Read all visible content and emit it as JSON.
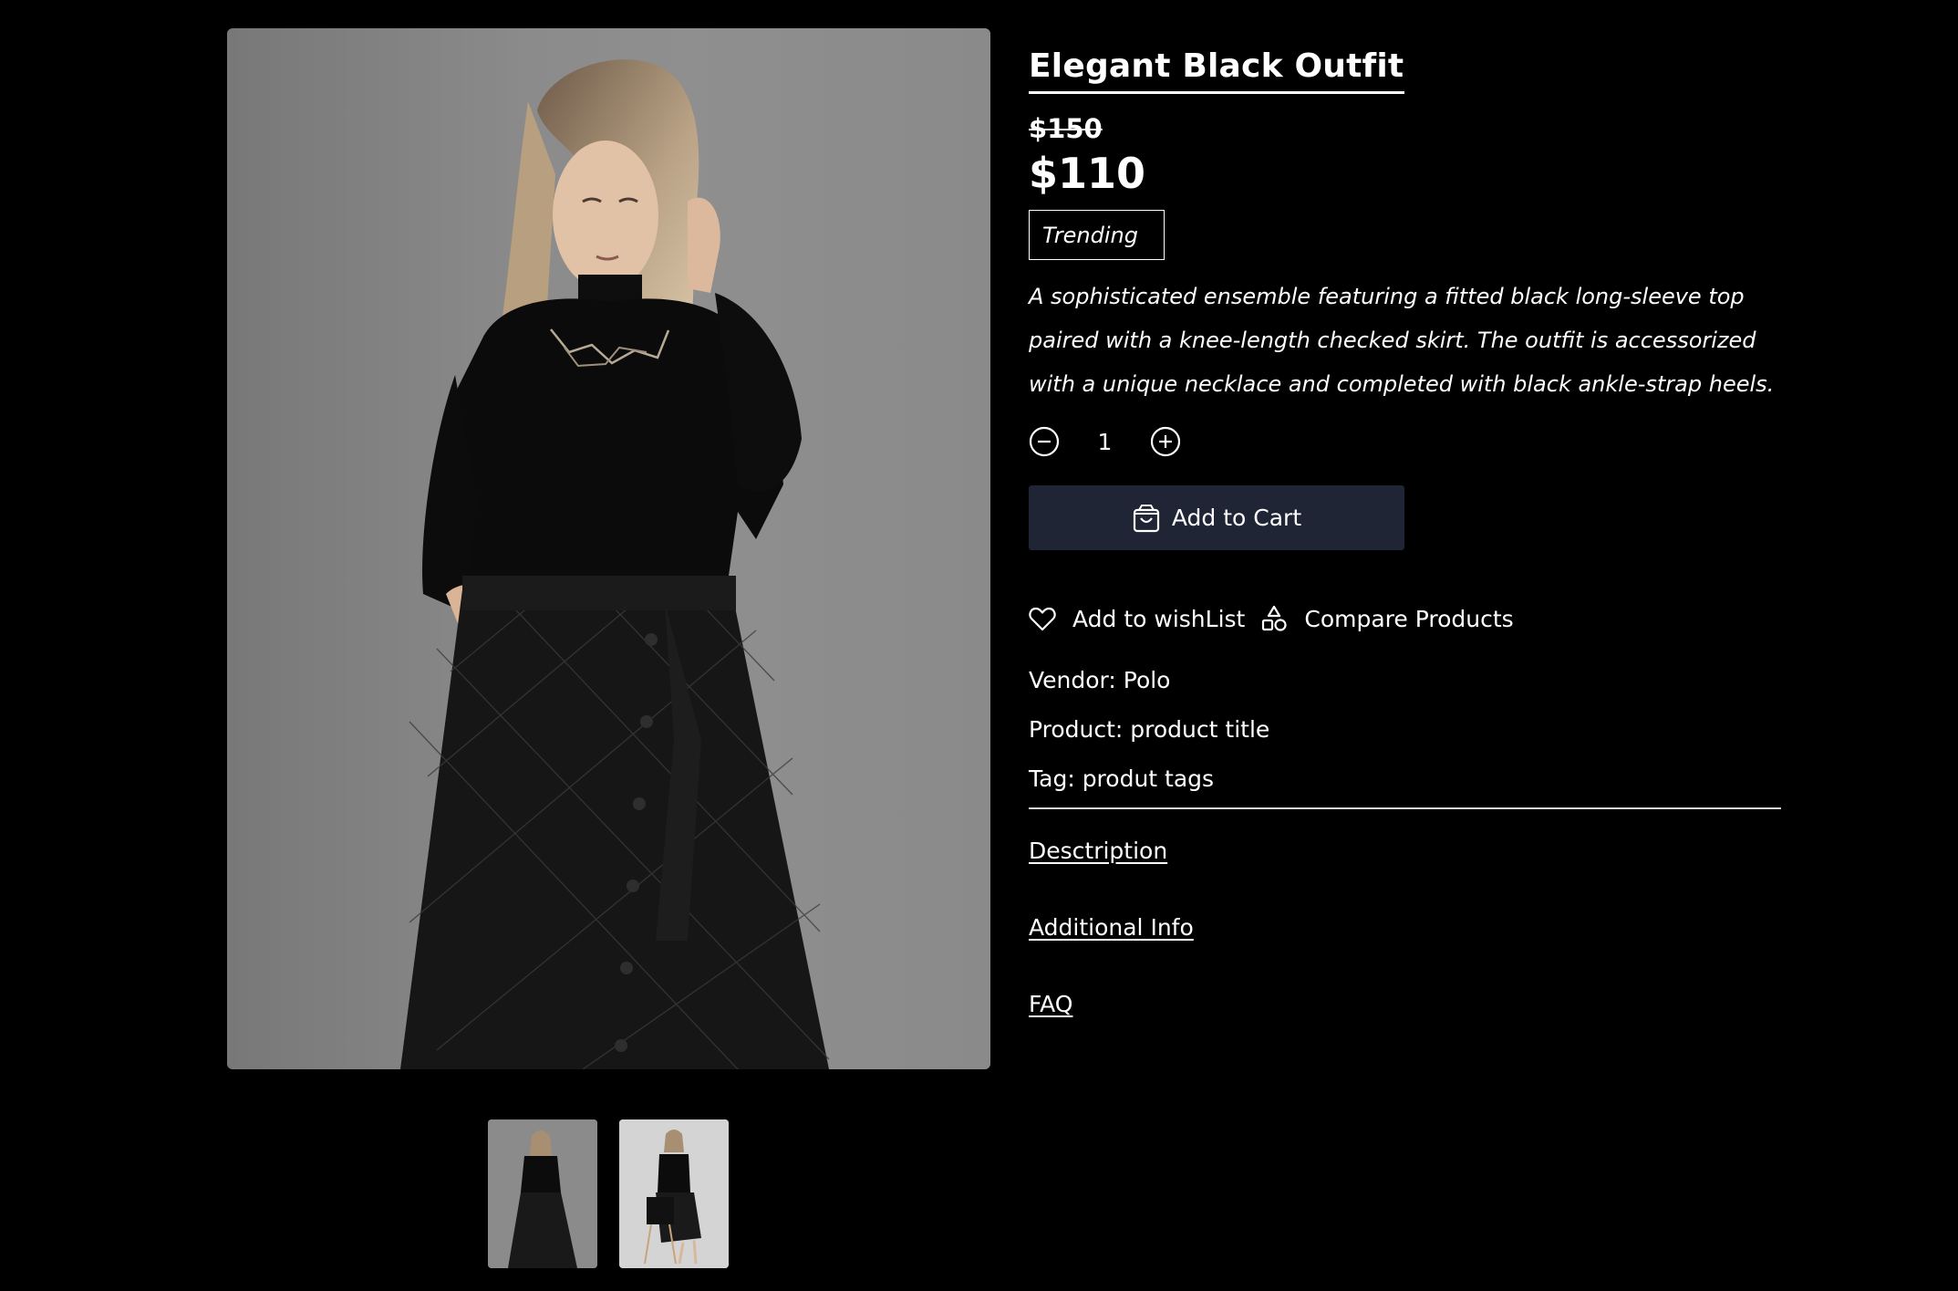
{
  "product": {
    "title": "Elegant Black Outfit",
    "old_price": "$150",
    "price": "$110",
    "badge": "Trending",
    "description": "A sophisticated ensemble featuring a fitted black long-sleeve top paired with a knee-length checked skirt. The outfit is accessorized with a unique necklace and completed with black ankle-strap heels."
  },
  "quantity": {
    "value": "1",
    "decrease_icon": "minus-circle-icon",
    "increase_icon": "plus-circle-icon"
  },
  "cart": {
    "label": "Add to Cart",
    "icon": "shopping-bag-icon"
  },
  "actions": {
    "wishlist_label": "Add to wishList",
    "wishlist_icon": "heart-icon",
    "compare_label": "Compare Products",
    "compare_icon": "shapes-icon"
  },
  "meta": {
    "vendor": "Vendor: Polo",
    "product": "Product: product title",
    "tag": "Tag: produt tags"
  },
  "tabs": {
    "description": "Desctription",
    "additional_info": "Additional Info",
    "faq": "FAQ"
  },
  "colors": {
    "background": "#000000",
    "text": "#ffffff",
    "cart_button": "#1f2535"
  }
}
